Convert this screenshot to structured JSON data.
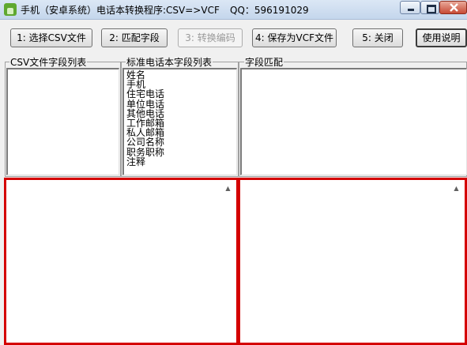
{
  "window": {
    "title": "手机（安卓系统）电话本转换程序:CSV=>VCF",
    "qq": "QQ：596191029"
  },
  "toolbar": {
    "select_csv": "1: 选择CSV文件",
    "match_fields": "2: 匹配字段",
    "convert_encoding": "3: 转换编码",
    "save_vcf": "4: 保存为VCF文件",
    "close": "5: 关闭",
    "help": "使用说明"
  },
  "groups": {
    "csv_fields": "CSV文件字段列表",
    "standard_fields": "标准电话本字段列表",
    "field_match": "字段匹配"
  },
  "standard_fields": [
    "姓名",
    "手机",
    "住宅电话",
    "单位电话",
    "其他电话",
    "工作邮箱",
    "私人邮箱",
    "公司名称",
    "职务职称",
    "注释"
  ],
  "colors": {
    "highlight_border": "#d40000"
  }
}
